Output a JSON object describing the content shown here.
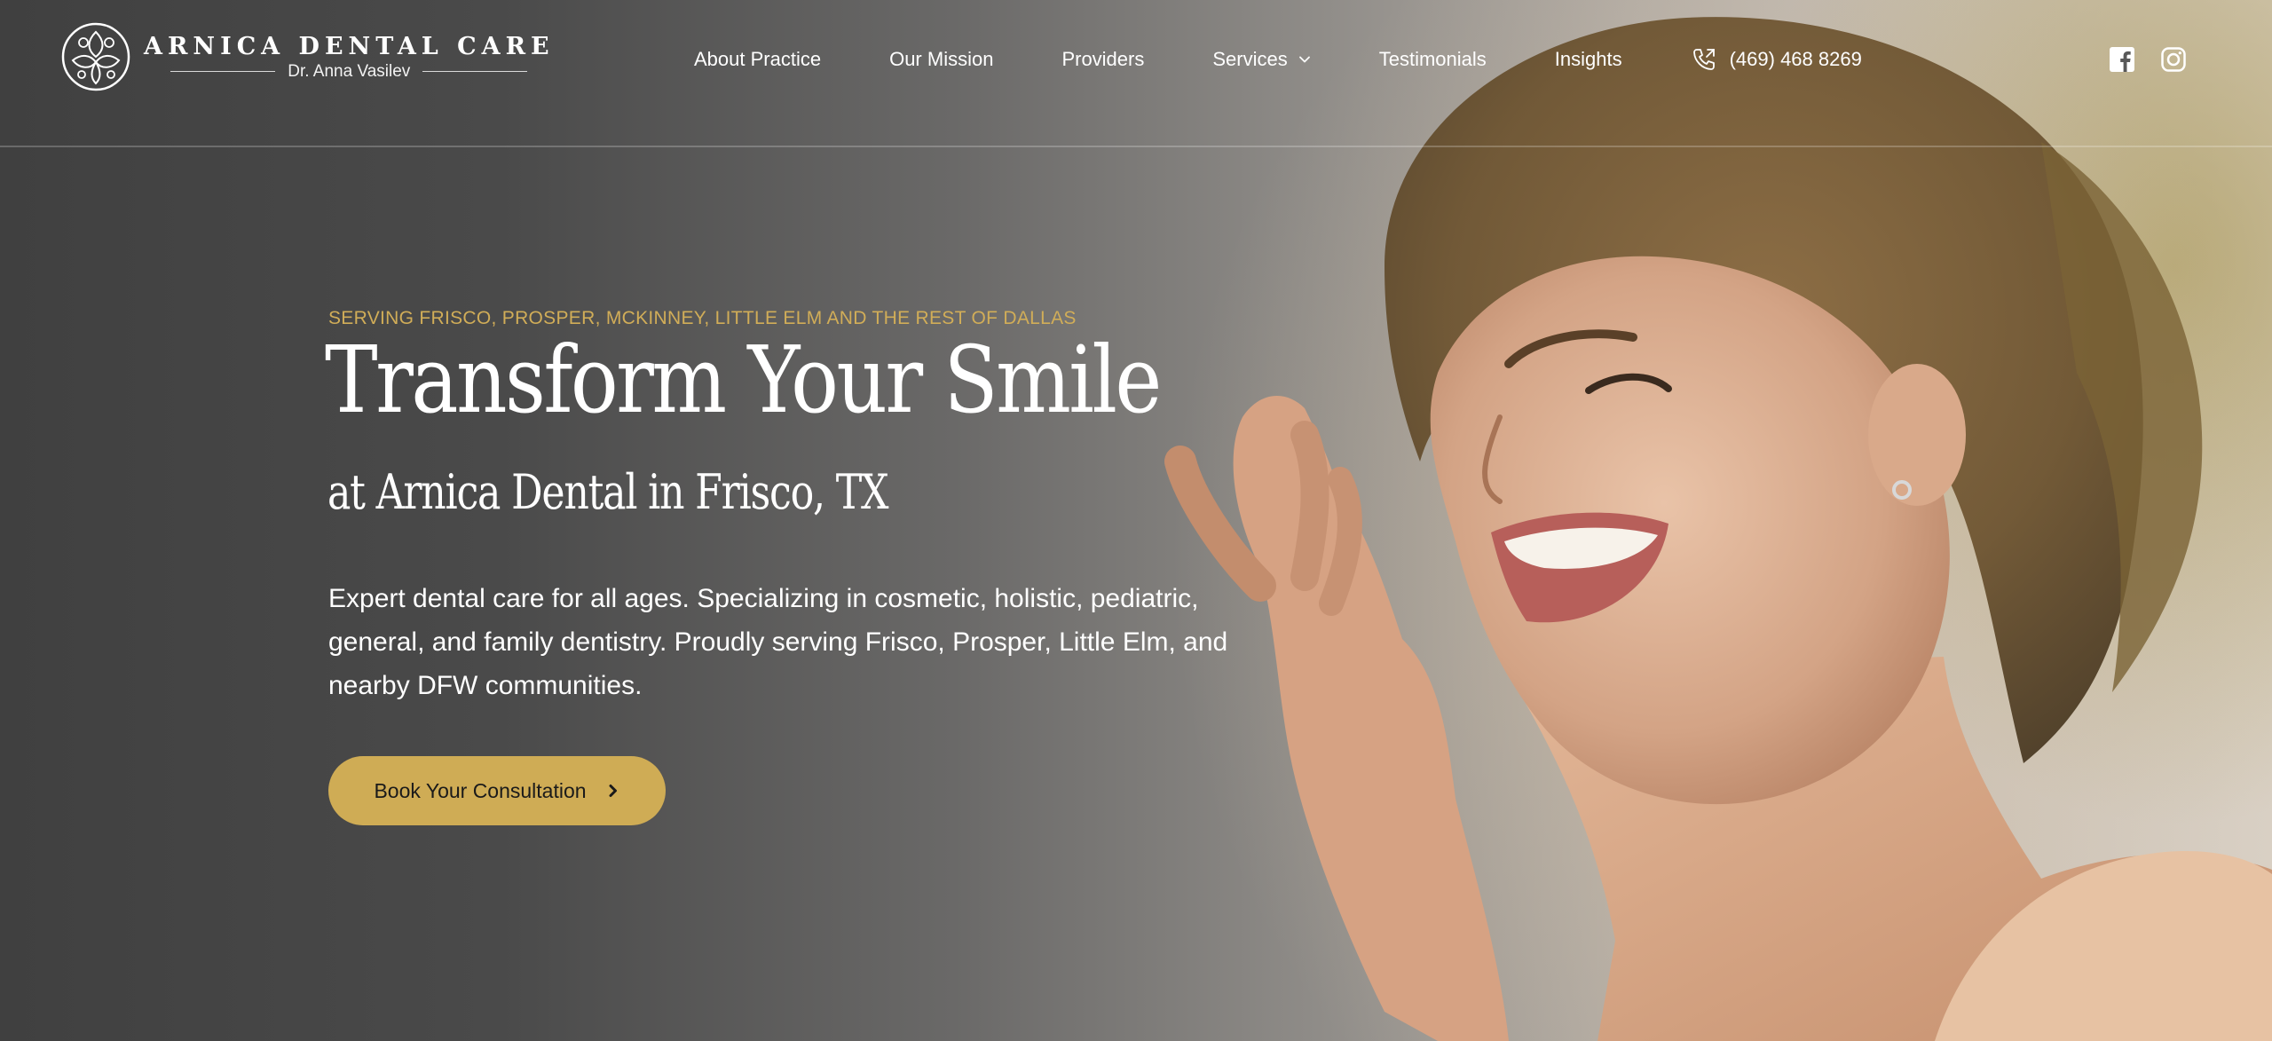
{
  "brand": {
    "name": "ARNICA DENTAL CARE",
    "doctor": "Dr. Anna Vasilev"
  },
  "nav": {
    "items": [
      {
        "label": "About Practice"
      },
      {
        "label": "Our Mission"
      },
      {
        "label": "Providers"
      },
      {
        "label": "Services",
        "dropdown": true
      },
      {
        "label": "Testimonials"
      },
      {
        "label": "Insights"
      }
    ],
    "phone": "(469) 468 8269",
    "phone_icon": "phone-icon",
    "socials": [
      {
        "icon": "facebook-icon"
      },
      {
        "icon": "instagram-icon"
      }
    ]
  },
  "hero": {
    "eyebrow": "SERVING FRISCO, PROSPER, MCKINNEY, LITTLE ELM AND THE REST OF DALLAS",
    "title": "Transform Your Smile",
    "subtitle": "at Arnica Dental in Frisco, TX",
    "description": "Expert dental care for all ages. Specializing in cosmetic, holistic, pediatric, general, and family dentistry. Proudly serving Frisco, Prosper, Little Elm, and nearby DFW communities.",
    "cta_label": "Book Your Consultation",
    "cta_icon": "chevron-right-icon"
  },
  "colors": {
    "accent": "#cfac55",
    "eyebrow": "#d1ad58",
    "text": "#ffffff"
  }
}
